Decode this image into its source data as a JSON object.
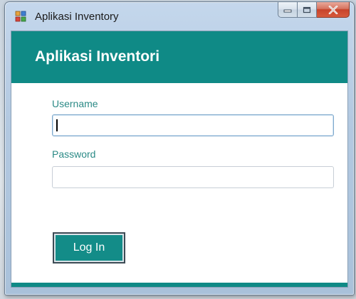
{
  "window": {
    "title": "Aplikasi Inventory",
    "icon": "app-icon",
    "controls": {
      "minimize_icon": "minimize-icon",
      "maximize_icon": "maximize-icon",
      "close_icon": "close-icon"
    }
  },
  "header": {
    "title": "Aplikasi Inventori"
  },
  "form": {
    "username_label": "Username",
    "username_value": "",
    "password_label": "Password",
    "password_value": "",
    "login_label": "Log In"
  },
  "colors": {
    "accent": "#0f8a86",
    "label_text": "#2b8a86",
    "close_button": "#c7432a"
  }
}
